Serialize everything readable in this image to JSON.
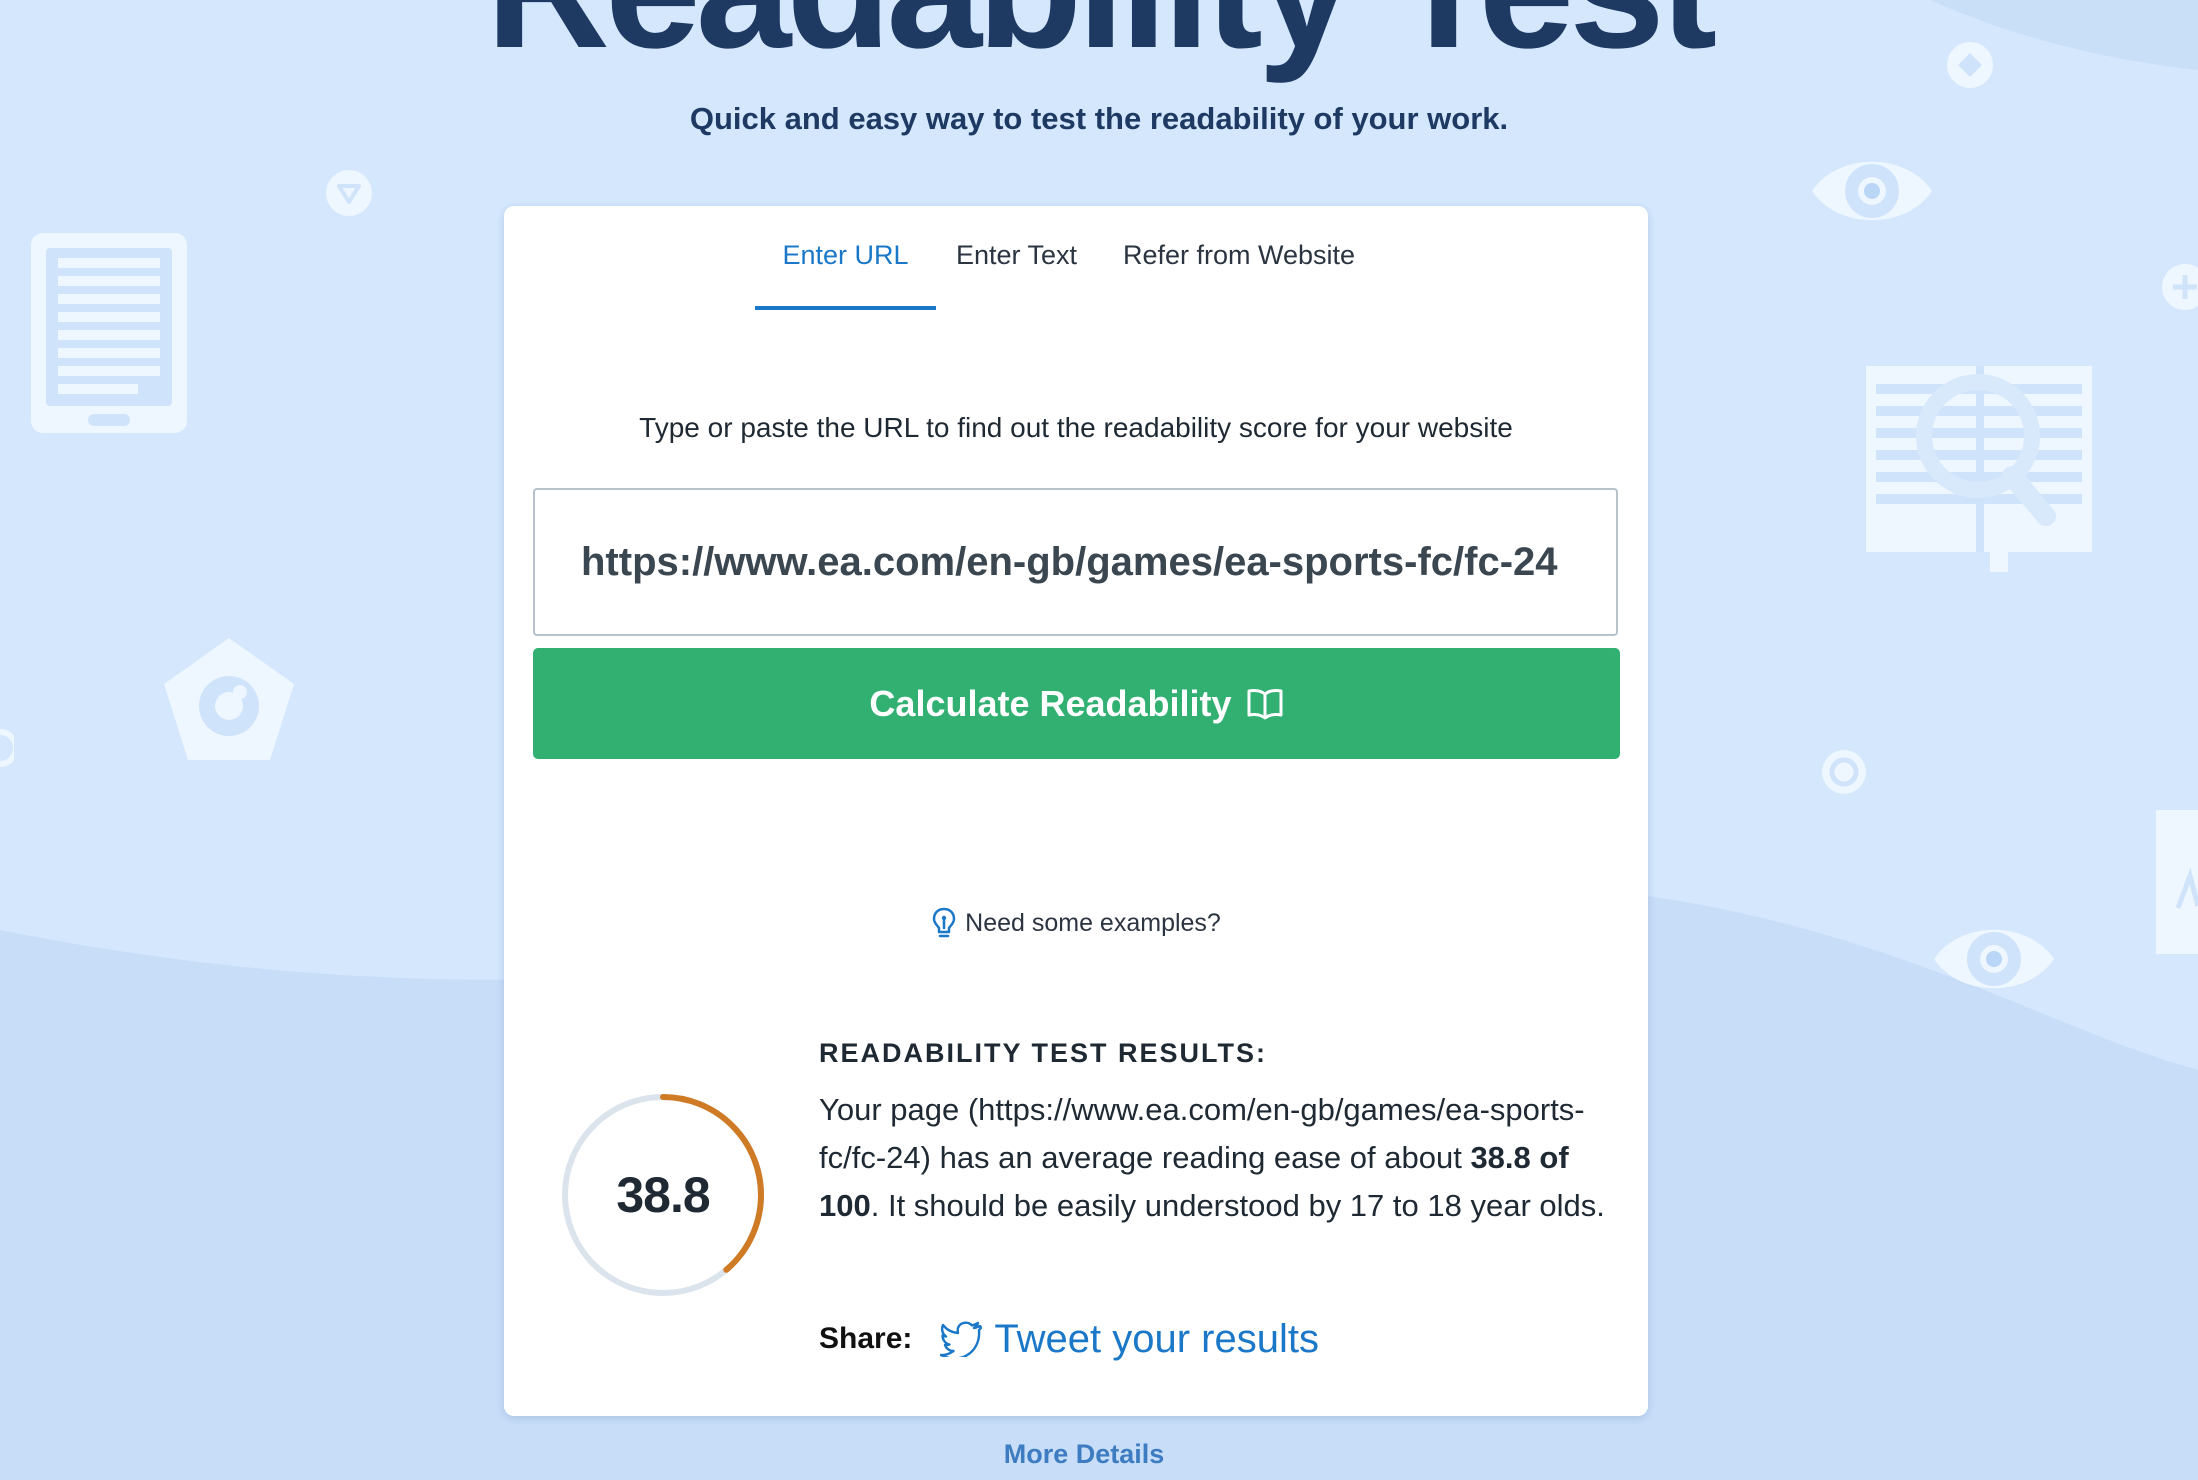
{
  "hero": {
    "title": "Readability Test",
    "subtitle": "Quick and easy way to test the readability of your work."
  },
  "tabs": [
    {
      "label": "Enter URL",
      "active": true
    },
    {
      "label": "Enter Text",
      "active": false
    },
    {
      "label": "Refer from Website",
      "active": false
    }
  ],
  "form": {
    "instructions": "Type or paste the URL to find out the readability score for your website",
    "url_value": "https://www.ea.com/en-gb/games/ea-sports-fc/fc-24",
    "calculate_label": "Calculate Readability",
    "calculate_icon": "book-open-icon",
    "examples_label": "Need some examples?",
    "examples_icon": "lightbulb-icon"
  },
  "results": {
    "heading": "READABILITY TEST RESULTS:",
    "score": "38.8",
    "score_max": 100,
    "score_fraction": 0.388,
    "text_before": "Your page (https://www.ea.com/en-gb/games/ea-sports-fc/fc-24) has an average reading ease of about ",
    "score_phrase": "38.8 of 100",
    "text_after": ". It should be easily understood by 17 to 18 year olds.",
    "share_label": "Share:",
    "tweet_label": "Tweet your results",
    "tweet_icon": "twitter-bird-icon"
  },
  "footer": {
    "more_details": "More Details"
  },
  "colors": {
    "background": "#d4e7fd",
    "background_wave": "#c7ddf8",
    "title": "#1e3a63",
    "accent_blue": "#1b78c8",
    "button_green": "#31b072",
    "ring_progress": "#cf7a24",
    "ring_track": "#dbe3ec",
    "decor_icon": "#e9f3ff"
  }
}
